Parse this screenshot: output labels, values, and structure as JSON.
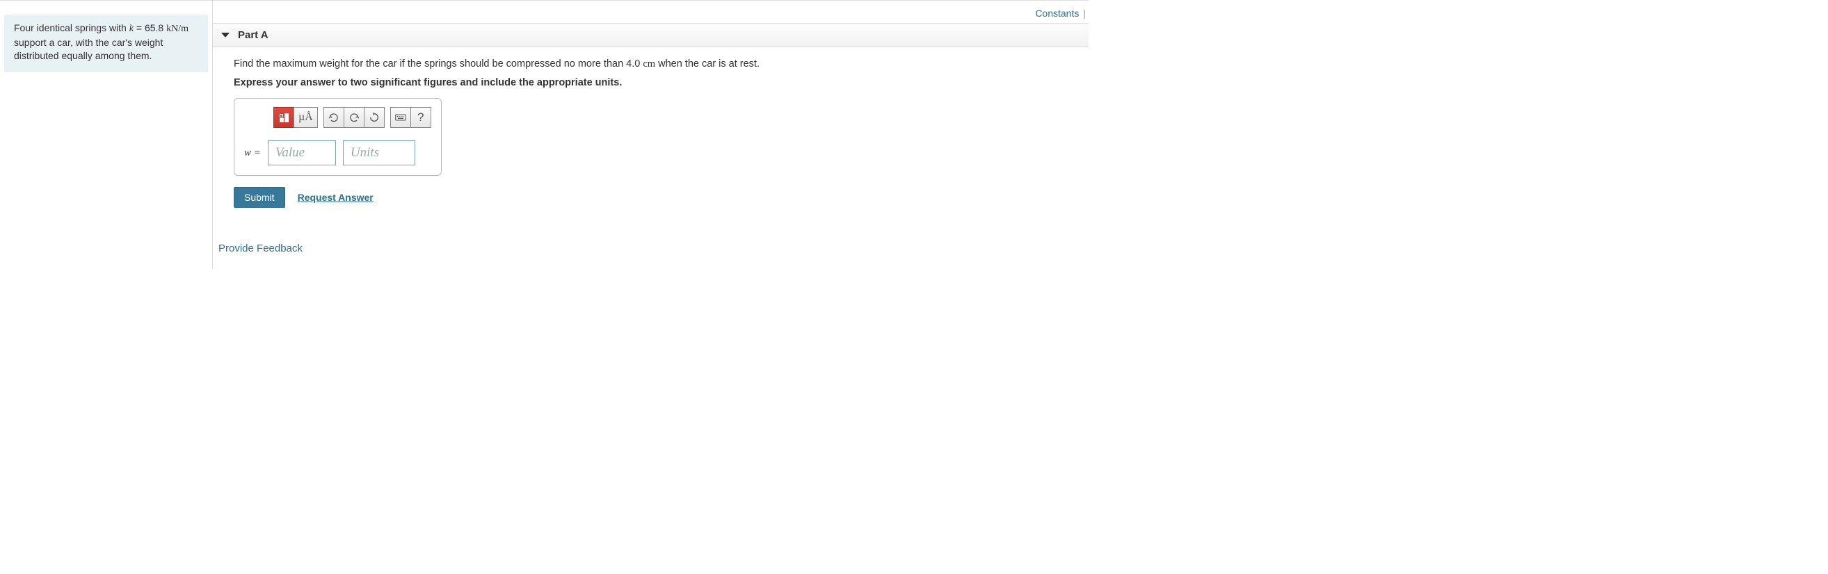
{
  "top_links": {
    "constants": "Constants",
    "separator": "|"
  },
  "problem": {
    "pre_k": "Four identical springs with ",
    "k_var": "k",
    "equals": " = ",
    "k_value": "65.8",
    "k_unit": "kN/m",
    "post_k": " support a car, with the car's weight distributed equally among them."
  },
  "part": {
    "label": "Part A",
    "question_pre": "Find the maximum weight for the car if the springs should be compressed no more than 4.0 ",
    "question_unit": "cm",
    "question_post": " when the car is at rest.",
    "instruction": "Express your answer to two significant figures and include the appropriate units."
  },
  "answer": {
    "var_label": "w =",
    "value_placeholder": "Value",
    "units_placeholder": "Units",
    "value": "",
    "units": ""
  },
  "toolbar": {
    "mu_label": "µÅ"
  },
  "actions": {
    "submit": "Submit",
    "request_answer": "Request Answer"
  },
  "feedback": "Provide Feedback"
}
